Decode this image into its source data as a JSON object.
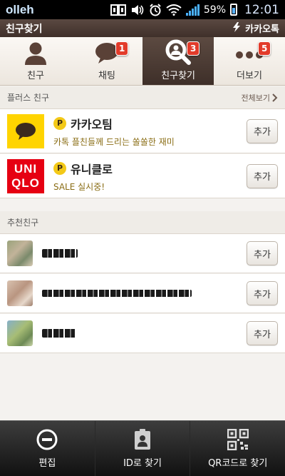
{
  "status_bar": {
    "carrier": "olleh",
    "battery_percent": "59%",
    "time": "12:01",
    "icons": [
      "nfc-icon",
      "volume-icon",
      "alarm-icon",
      "wifi-icon",
      "signal-icon",
      "battery-icon"
    ]
  },
  "header": {
    "title": "친구찾기",
    "brand": "카카오톡"
  },
  "tabs": [
    {
      "label": "친구",
      "icon": "person-icon",
      "badge": ""
    },
    {
      "label": "채팅",
      "icon": "chat-bubble-icon",
      "badge": "1"
    },
    {
      "label": "친구찾기",
      "icon": "search-friend-icon",
      "badge": "3",
      "active": true
    },
    {
      "label": "더보기",
      "icon": "more-dots-icon",
      "badge": "5"
    }
  ],
  "plus_section": {
    "title": "플러스 친구",
    "see_all": "전체보기",
    "items": [
      {
        "name": "카카오팀",
        "subtitle": "카톡 플친들께 드리는 쏠쏠한 재미",
        "add_label": "추가"
      },
      {
        "name": "유니클로",
        "subtitle": "SALE 실시중!",
        "add_label": "추가",
        "logo_text_1": "UNI",
        "logo_text_2": "QLO"
      }
    ]
  },
  "recommended_section": {
    "title": "추천친구",
    "items": [
      {
        "add_label": "추가"
      },
      {
        "add_label": "추가"
      },
      {
        "add_label": "추가"
      }
    ]
  },
  "bottom_bar": {
    "items": [
      {
        "label": "편집",
        "icon": "minus-circle-icon"
      },
      {
        "label": "ID로 찾기",
        "icon": "id-card-icon"
      },
      {
        "label": "QR코드로 찾기",
        "icon": "qr-code-icon"
      }
    ]
  },
  "colors": {
    "header_brown": "#4e3d35",
    "kakao_yellow": "#ffd400",
    "uniqlo_red": "#e60012",
    "badge_red": "#e23b2a"
  }
}
